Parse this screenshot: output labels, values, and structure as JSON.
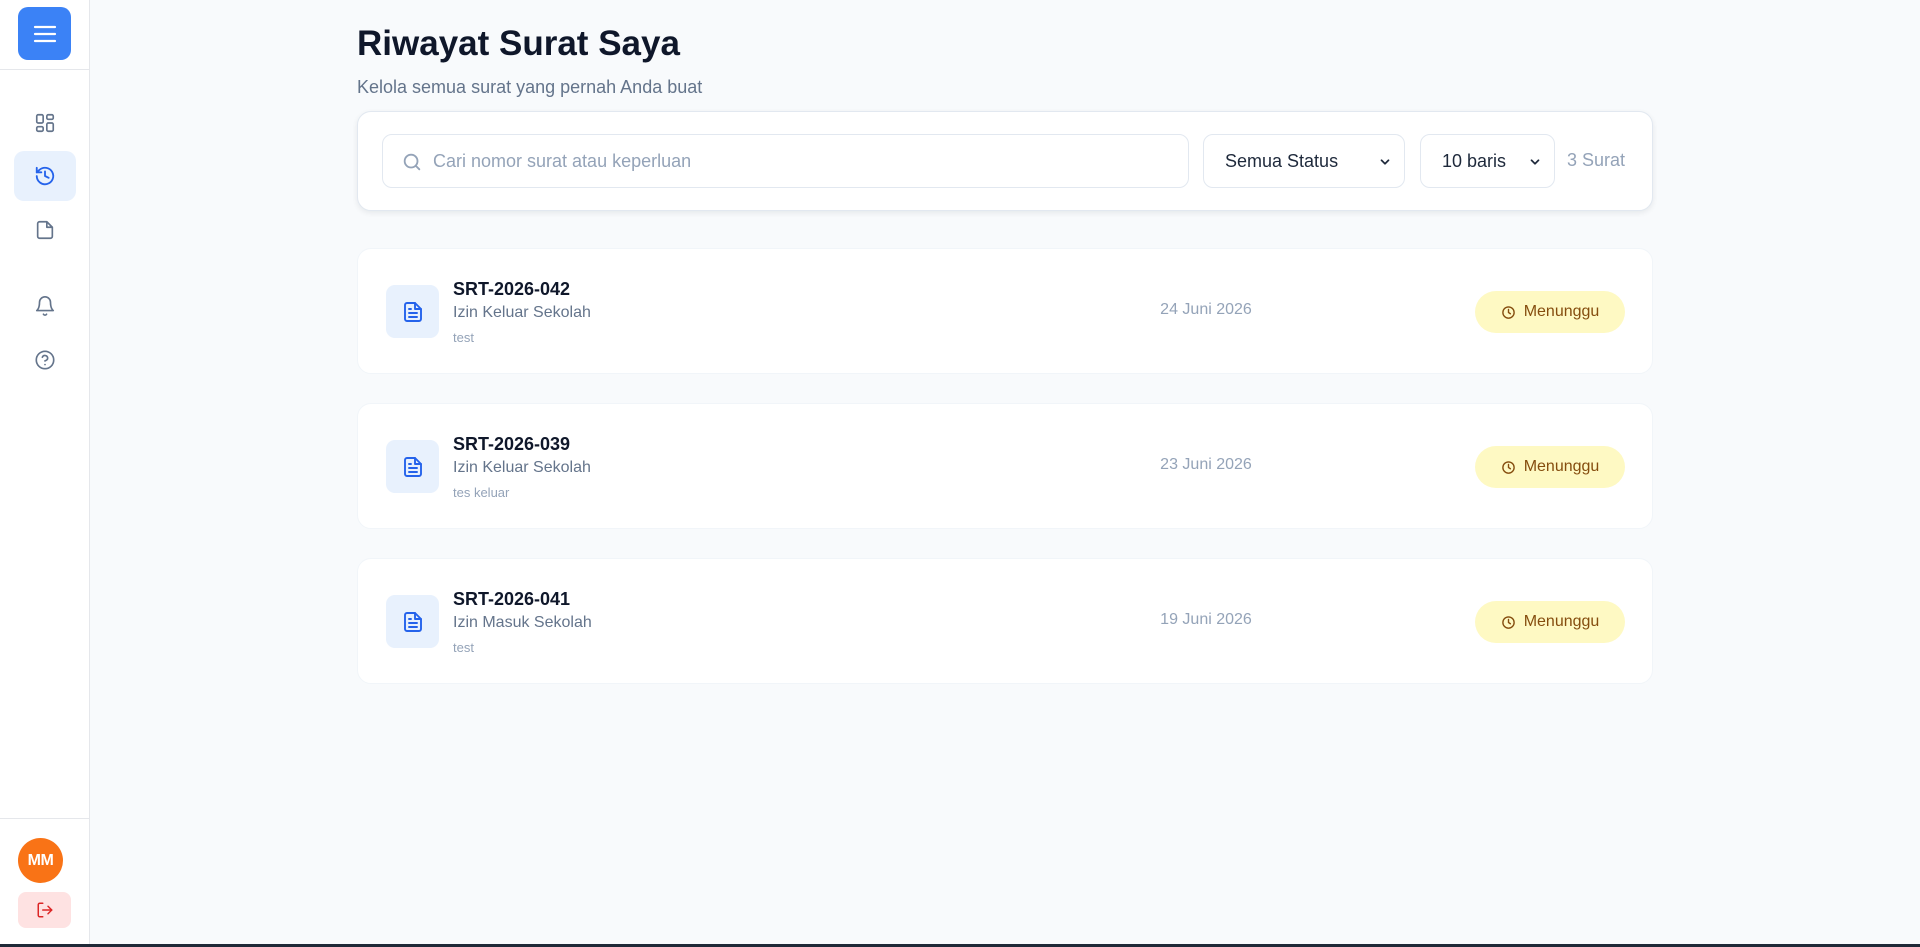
{
  "sidebar": {
    "menu_icon": "menu-icon",
    "nav": [
      {
        "id": "dashboard",
        "icon": "dashboard-icon",
        "active": false
      },
      {
        "id": "history",
        "icon": "history-icon",
        "active": true
      },
      {
        "id": "document",
        "icon": "document-icon",
        "active": false
      },
      {
        "id": "notifications",
        "icon": "bell-icon",
        "active": false
      },
      {
        "id": "help",
        "icon": "help-icon",
        "active": false
      }
    ],
    "user": {
      "initials": "MM",
      "color": "#f97316"
    },
    "logout_icon": "logout-icon"
  },
  "page": {
    "title": "Riwayat Surat Saya",
    "subtitle": "Kelola semua surat yang pernah Anda buat"
  },
  "filters": {
    "search": {
      "placeholder": "Cari nomor surat atau keperluan",
      "value": ""
    },
    "status": {
      "selected": "Semua Status"
    },
    "rows": {
      "selected": "10 baris"
    },
    "count": "3 Surat"
  },
  "letters": [
    {
      "number": "SRT-2026-042",
      "type": "Izin Keluar Sekolah",
      "note": "test",
      "date": "24 Juni 2026",
      "status": "Menunggu"
    },
    {
      "number": "SRT-2026-039",
      "type": "Izin Keluar Sekolah",
      "note": "tes keluar",
      "date": "23 Juni 2026",
      "status": "Menunggu"
    },
    {
      "number": "SRT-2026-041",
      "type": "Izin Masuk Sekolah",
      "note": "test",
      "date": "19 Juni 2026",
      "status": "Menunggu"
    }
  ],
  "colors": {
    "accent": "#3b82f6",
    "pending_bg": "#fef9c3",
    "pending_text": "#854d0e",
    "avatar": "#f97316"
  }
}
